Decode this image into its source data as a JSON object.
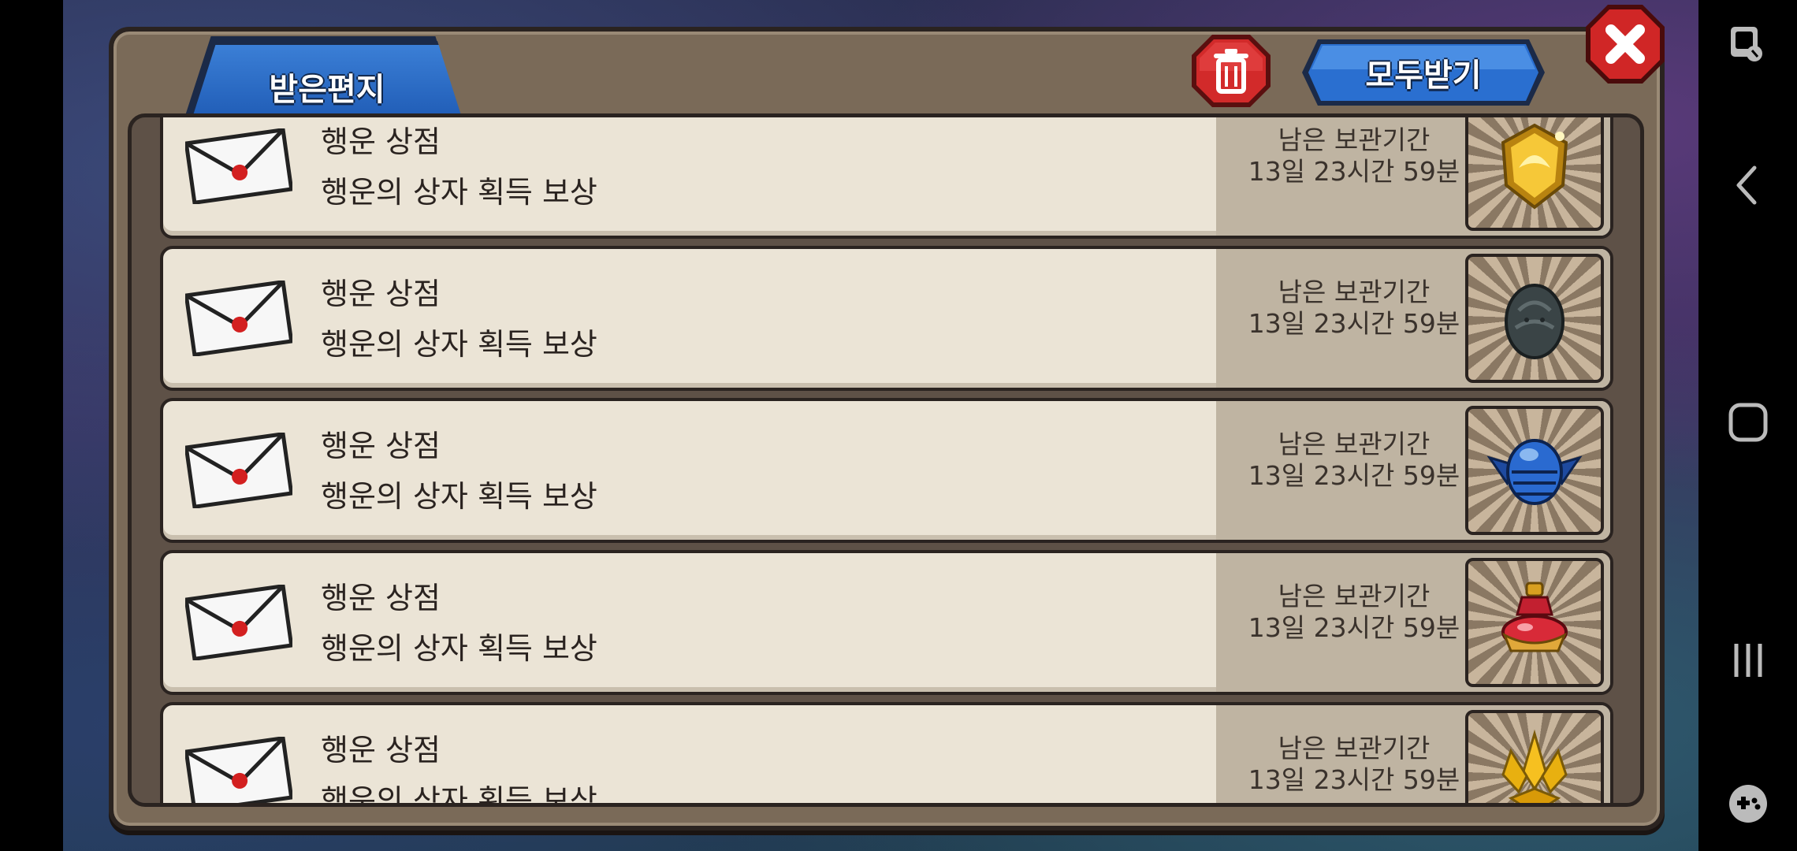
{
  "panel": {
    "tab_label": "받은편지",
    "receive_all_label": "모두받기",
    "delete_icon": "trash-icon",
    "close_icon": "close-icon"
  },
  "mails": [
    {
      "sender": "행운 상점",
      "subject": "행운의 상자 획득 보상",
      "remaining_label": "남은 보관기간",
      "remaining_value": "13일 23시간 59분",
      "reward_icon": "gold-crest-icon"
    },
    {
      "sender": "행운 상점",
      "subject": "행운의 상자 획득 보상",
      "remaining_label": "남은 보관기간",
      "remaining_value": "13일 23시간 59분",
      "reward_icon": "dark-egg-icon"
    },
    {
      "sender": "행운 상점",
      "subject": "행운의 상자 획득 보상",
      "remaining_label": "남은 보관기간",
      "remaining_value": "13일 23시간 59분",
      "reward_icon": "blue-winged-helmet-icon"
    },
    {
      "sender": "행운 상점",
      "subject": "행운의 상자 획득 보상",
      "remaining_label": "남은 보관기간",
      "remaining_value": "13일 23시간 59분",
      "reward_icon": "red-potion-icon"
    },
    {
      "sender": "행운 상점",
      "subject": "행운의 상자 획득 보상",
      "remaining_label": "남은 보관기간",
      "remaining_value": "13일 23시간 59분",
      "reward_icon": "gold-crystal-icon"
    }
  ],
  "system_nav": {
    "icons": [
      "assistive-touch-icon",
      "back-icon",
      "home-icon",
      "recents-icon",
      "game-tools-icon"
    ]
  }
}
